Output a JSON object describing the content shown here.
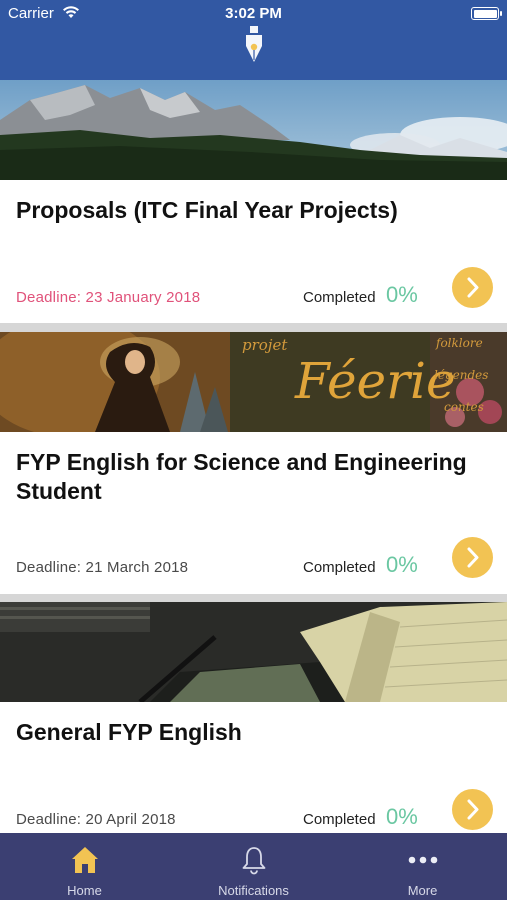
{
  "status_bar": {
    "carrier": "Carrier",
    "time": "3:02 PM"
  },
  "colors": {
    "nav_background": "#3258a3",
    "tab_background": "#3b3f72",
    "accent_yellow": "#f2c353",
    "percent_green": "#6bc7a2",
    "deadline_urgent": "#e0527a"
  },
  "projects": [
    {
      "title": "Proposals (ITC Final Year Projects)",
      "deadline": "Deadline: 23 January 2018",
      "completed_label": "Completed",
      "completed_value": "0%"
    },
    {
      "title": "FYP English for Science and Engineering Student",
      "banner_text": "Féerie",
      "banner_side_texts": [
        "projet",
        "folklore",
        "légendes",
        "contes"
      ],
      "deadline": "Deadline: 21 March 2018",
      "completed_label": "Completed",
      "completed_value": "0%"
    },
    {
      "title": "General FYP English",
      "deadline": "Deadline: 20 April 2018",
      "completed_label": "Completed",
      "completed_value": "0%"
    }
  ],
  "tabbar": {
    "home": "Home",
    "notifications": "Notifications",
    "more": "More"
  }
}
